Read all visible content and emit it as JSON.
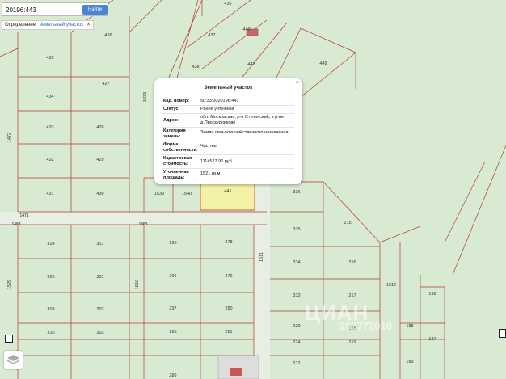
{
  "search": {
    "value": "20196:443",
    "button_label": "Найти"
  },
  "define": {
    "label": "Определение:",
    "selected": "земельный участок",
    "clear": "✕"
  },
  "popup": {
    "title": "Земельный участок",
    "close": "×",
    "rows": [
      {
        "key": "Кад. номер:",
        "value": "50:33:0020196:443"
      },
      {
        "key": "Статус:",
        "value": "Ранее учтенный"
      },
      {
        "key": "Адрес:",
        "value": "обл. Московская, р-н Ступинский, в р-не д.Проскурниково"
      },
      {
        "key": "Категория земель:",
        "value": "Земли сельскохозяйственного назначения"
      },
      {
        "key": "Форма собственности:",
        "value": "Частная"
      },
      {
        "key": "Кадастровая стоимость:",
        "value": "1114527.96 руб"
      },
      {
        "key": "Уточненная площадь:",
        "value": "1521 кв.м"
      }
    ]
  },
  "colors": {
    "map_background": "#d9ead3",
    "parcel_border": "#b33a2e",
    "selected_parcel": "#f3f1a6",
    "road": "#e9efe6",
    "accent_button": "#4a87d2"
  },
  "icons": {
    "layers": "layers-icon",
    "zoom": "zoom-indicator-icon"
  },
  "watermark": {
    "main": "ЦИАН",
    "sub": "263772010"
  },
  "parcels": [
    "436",
    "426",
    "437",
    "440",
    "438",
    "447",
    "449",
    "435",
    "427",
    "1433",
    "434",
    "433",
    "428",
    "432",
    "429",
    "431",
    "430",
    "1539",
    "1540",
    "441",
    "336",
    "1472",
    "1471",
    "1488",
    "1483",
    "215",
    "324",
    "317",
    "295",
    "278",
    "1511",
    "335",
    "325",
    "301",
    "296",
    "279",
    "334",
    "216",
    "1529",
    "1510",
    "1512",
    "198",
    "333",
    "217",
    "309",
    "302",
    "297",
    "280",
    "229",
    "188",
    "310",
    "303",
    "285",
    "281",
    "218",
    "187",
    "224",
    "219",
    "189",
    "286",
    "212"
  ]
}
